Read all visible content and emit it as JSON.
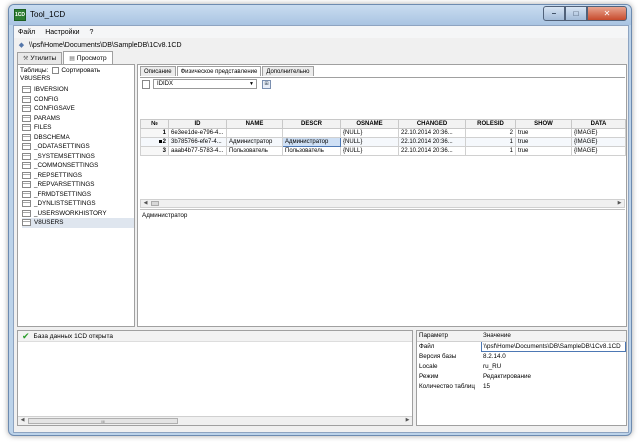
{
  "window": {
    "title": "Tool_1CD",
    "app_icon": "1CD"
  },
  "menu": [
    "Файл",
    "Настройки",
    "?"
  ],
  "path": "\\\\psf\\Home\\Documents\\DB\\SampleDB\\1Cv8.1CD",
  "main_tabs": [
    {
      "label": "Утилиты",
      "active": false
    },
    {
      "label": "Просмотр",
      "active": true
    }
  ],
  "left": {
    "tables_label": "Таблицы:",
    "sort_label": "Сортировать",
    "current_table": "V8USERS",
    "tables": [
      "IBVERSION",
      "CONFIG",
      "CONFIGSAVE",
      "PARAMS",
      "FILES",
      "DBSCHEMA",
      "_ODATASETTINGS",
      "_SYSTEMSETTINGS",
      "_COMMONSETTINGS",
      "_REPSETTINGS",
      "_REPVARSETTINGS",
      "_FRMDTSETTINGS",
      "_DYNLISTSETTINGS",
      "_USERSWORKHISTORY",
      "V8USERS"
    ],
    "selected_index": 14
  },
  "sub_tabs": [
    {
      "label": "Описание",
      "active": false
    },
    {
      "label": "Физическое представление",
      "active": true
    },
    {
      "label": "Дополнительно",
      "active": false
    }
  ],
  "index_combo": "IDIDX",
  "grid": {
    "columns": [
      "№",
      "ID",
      "NAME",
      "DESCR",
      "OSNAME",
      "CHANGED",
      "ROLESID",
      "SHOW",
      "DATA"
    ],
    "rows": [
      [
        "1",
        "6e3ee1de-e796-4...",
        "",
        "",
        "{NULL}",
        "22.10.2014 20:36...",
        "2",
        "true",
        "{IMAGE}"
      ],
      [
        "2",
        "3b785766-efe7-4...",
        "Администратор",
        "Администратор",
        "{NULL}",
        "22.10.2014 20:36...",
        "1",
        "true",
        "{IMAGE}"
      ],
      [
        "3",
        "aaab4b77-5783-4...",
        "Пользователь",
        "Пользователь",
        "{NULL}",
        "22.10.2014 20:36...",
        "1",
        "true",
        "{IMAGE}"
      ]
    ],
    "current_row": 1
  },
  "value_text": "Администратор",
  "log": {
    "message": "База данных 1CD открыта"
  },
  "scroll_label": "III",
  "props": {
    "headers": [
      "Параметр",
      "Значение"
    ],
    "rows": [
      [
        "Файл",
        "\\\\psf\\Home\\Documents\\DB\\SampleDB\\1Cv8.1CD"
      ],
      [
        "Версия базы",
        "8.2.14.0"
      ],
      [
        "Locale",
        "ru_RU"
      ],
      [
        "Режим",
        "Редактирование"
      ],
      [
        "Количество таблиц",
        "15"
      ]
    ]
  },
  "colors": {
    "accent": "#4d78b4",
    "check": "#2a9d2a",
    "close": "#c74a2c"
  }
}
